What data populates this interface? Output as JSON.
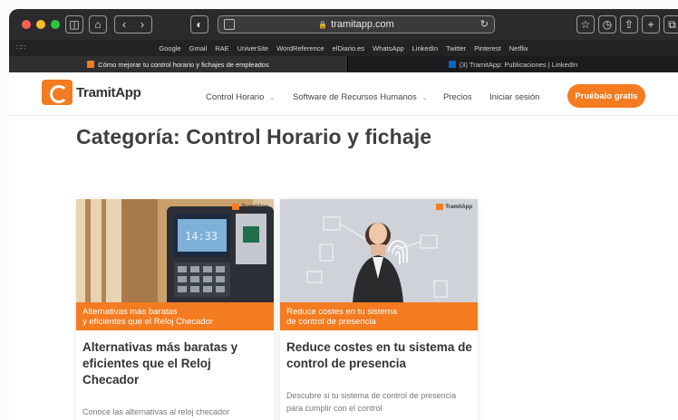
{
  "browser": {
    "url": "tramitapp.com",
    "favorites": [
      "Google",
      "Gmail",
      "RAE",
      "UniverSite",
      "WordReference",
      "elDiario.es",
      "WhatsApp",
      "LinkedIn",
      "Twitter",
      "Pinterest",
      "Netflix"
    ],
    "tabs": [
      {
        "label": "Cómo mejorar tu control horario y fichajes de empleados",
        "active": true
      },
      {
        "label": "(3) TramitApp: Publicaciones | LinkedIn",
        "active": false
      }
    ]
  },
  "site": {
    "logo_text": "TramitApp",
    "nav": {
      "control_horario": "Control Horario",
      "software_rrhh": "Software de Recursos Humanos",
      "precios": "Precios",
      "login": "Iniciar sesión"
    },
    "cta": "Pruébalo gratis"
  },
  "page": {
    "heading": "Categoría: Control Horario y fichaje",
    "cards": [
      {
        "banner_line1": "Alternativas más baratas",
        "banner_line2": "y eficientes que el Reloj Checador",
        "title": "Alternativas más baratas y eficientes que el Reloj Checador",
        "excerpt": "Conoce las alternativas al reloj checador",
        "thumb_logo": "TramitApp"
      },
      {
        "banner_line1": "Reduce costes en tu sistema",
        "banner_line2": "de control de presencia",
        "title": "Reduce costes en tu sistema de control de presencia",
        "excerpt": "Descubre si tu sistema de control de presencia para cumplir con el control",
        "thumb_logo": "TramitApp"
      }
    ]
  },
  "colors": {
    "brand_orange": "#f47b20",
    "close": "#fe5f57",
    "minimize": "#febc2e",
    "zoom": "#28c840"
  }
}
